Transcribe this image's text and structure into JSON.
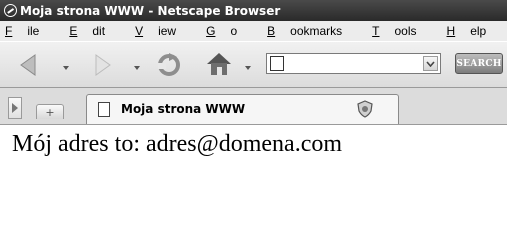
{
  "window": {
    "title": "Moja strona WWW - Netscape Browser"
  },
  "menubar": {
    "items": [
      {
        "label": "File",
        "u": "F",
        "rest": "ile"
      },
      {
        "label": "Edit",
        "u": "E",
        "rest": "dit"
      },
      {
        "label": "View",
        "u": "V",
        "rest": "iew"
      },
      {
        "label": "Go",
        "u": "G",
        "rest": "o"
      },
      {
        "label": "Bookmarks",
        "u": "B",
        "rest": "ookmarks"
      },
      {
        "label": "Tools",
        "u": "T",
        "rest": "ools"
      },
      {
        "label": "Help",
        "u": "H",
        "rest": "elp"
      }
    ]
  },
  "toolbar": {
    "icons": [
      "back-icon",
      "forward-icon",
      "reload-icon",
      "home-icon"
    ],
    "url_value": "",
    "search_label": "SEARCH"
  },
  "tabs": [
    {
      "title": "Moja strona WWW",
      "active": true
    }
  ],
  "content": {
    "text": "Mój adres to: adres@domena.com"
  }
}
